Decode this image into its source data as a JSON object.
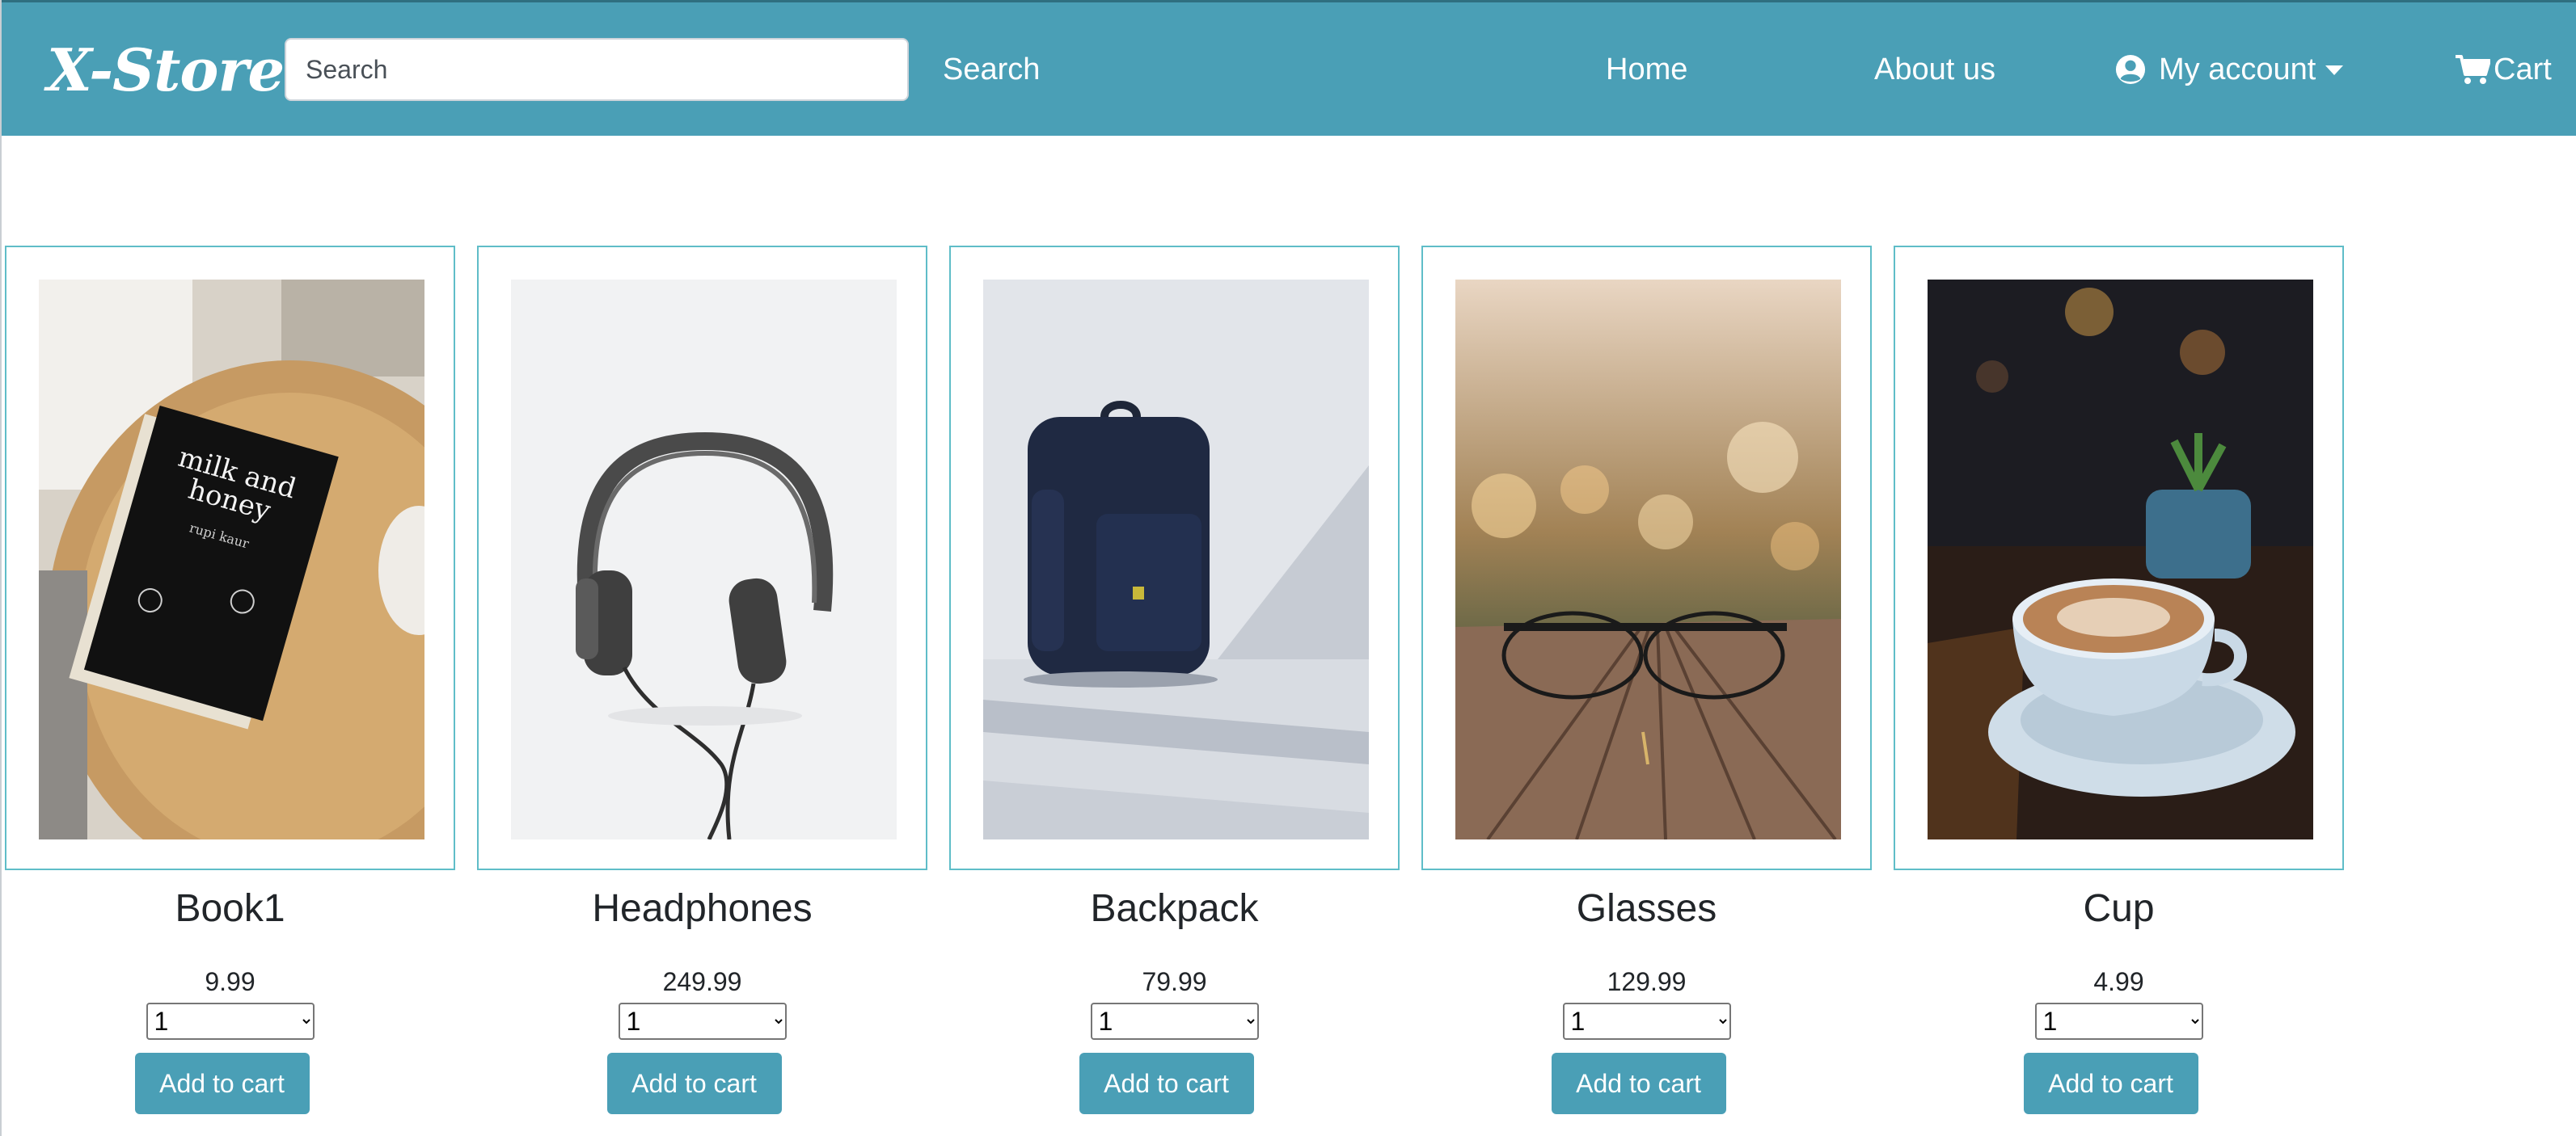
{
  "navbar": {
    "brand": "X-Store",
    "search_placeholder": "Search",
    "search_button": "Search",
    "links": {
      "home": "Home",
      "about": "About us",
      "account": "My account",
      "cart": "Cart"
    },
    "icons": {
      "account": "user-circle-icon",
      "cart": "shopping-cart-icon",
      "caret": "caret-down-icon"
    },
    "colors": {
      "navbar_bg": "#4a9fb6",
      "button_bg": "#4a9fb6",
      "card_border": "#5fbdc8"
    }
  },
  "products": [
    {
      "name": "Book1",
      "price": "9.99",
      "qty": "1",
      "button": "Add to cart",
      "image": "book-milk-and-honey-photo",
      "image_text": [
        "milk and",
        "honey",
        "rupi kaur"
      ]
    },
    {
      "name": "Headphones",
      "price": "249.99",
      "qty": "1",
      "button": "Add to cart",
      "image": "headphones-photo"
    },
    {
      "name": "Backpack",
      "price": "79.99",
      "qty": "1",
      "button": "Add to cart",
      "image": "backpack-photo"
    },
    {
      "name": "Glasses",
      "price": "129.99",
      "qty": "1",
      "button": "Add to cart",
      "image": "glasses-photo"
    },
    {
      "name": "Cup",
      "price": "4.99",
      "qty": "1",
      "button": "Add to cart",
      "image": "coffee-cup-photo"
    }
  ]
}
